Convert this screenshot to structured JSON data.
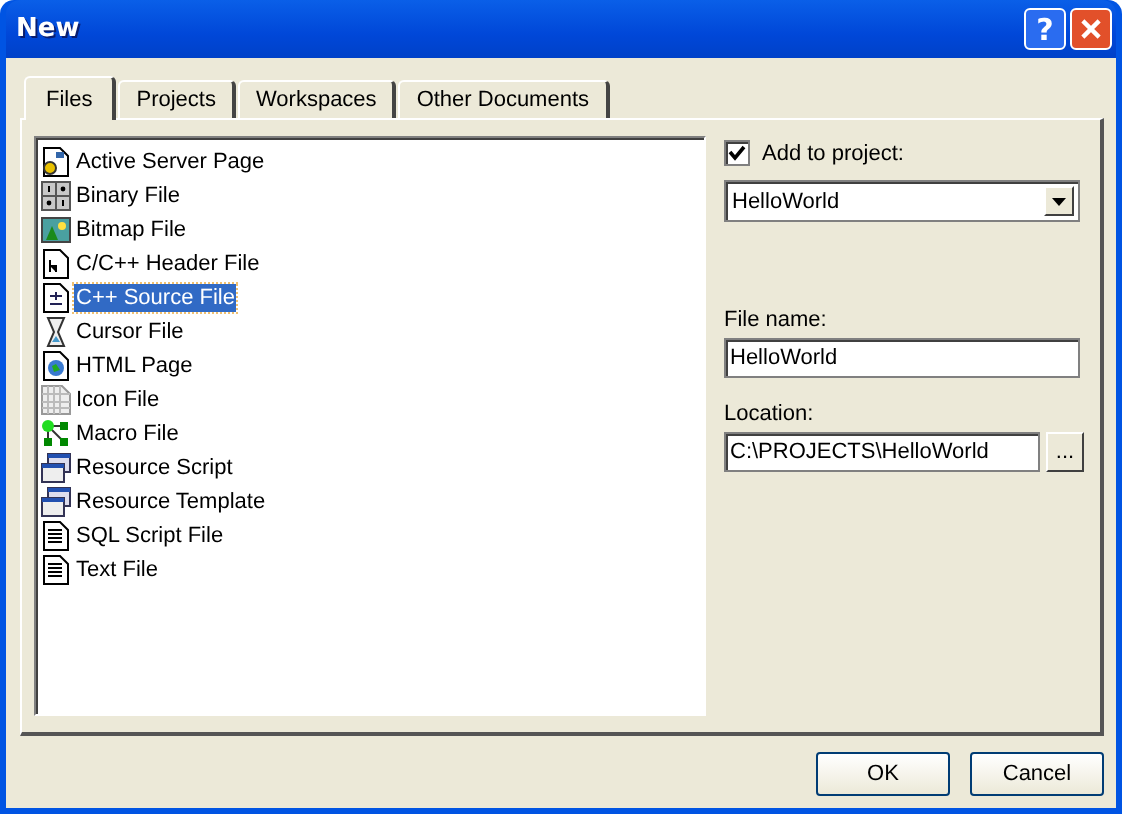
{
  "window": {
    "title": "New",
    "help_button": "?"
  },
  "tabs": [
    {
      "label": "Files",
      "selected": true
    },
    {
      "label": "Projects",
      "selected": false
    },
    {
      "label": "Workspaces",
      "selected": false
    },
    {
      "label": "Other Documents",
      "selected": false
    }
  ],
  "file_types": [
    {
      "label": "Active Server Page",
      "selected": false
    },
    {
      "label": "Binary File",
      "selected": false
    },
    {
      "label": "Bitmap File",
      "selected": false
    },
    {
      "label": "C/C++ Header File",
      "selected": false
    },
    {
      "label": "C++ Source File",
      "selected": true
    },
    {
      "label": "Cursor File",
      "selected": false
    },
    {
      "label": "HTML Page",
      "selected": false
    },
    {
      "label": "Icon File",
      "selected": false
    },
    {
      "label": "Macro File",
      "selected": false
    },
    {
      "label": "Resource Script",
      "selected": false
    },
    {
      "label": "Resource Template",
      "selected": false
    },
    {
      "label": "SQL Script File",
      "selected": false
    },
    {
      "label": "Text File",
      "selected": false
    }
  ],
  "add_to_project": {
    "label": "Add to project:",
    "checked": true
  },
  "project_dropdown": {
    "value": "HelloWorld"
  },
  "file_name": {
    "label": "File name:",
    "value": "HelloWorld"
  },
  "location": {
    "label": "Location:",
    "value": "C:\\PROJECTS\\HelloWorld",
    "browse_button": "..."
  },
  "buttons": [
    "OK",
    "Cancel"
  ]
}
